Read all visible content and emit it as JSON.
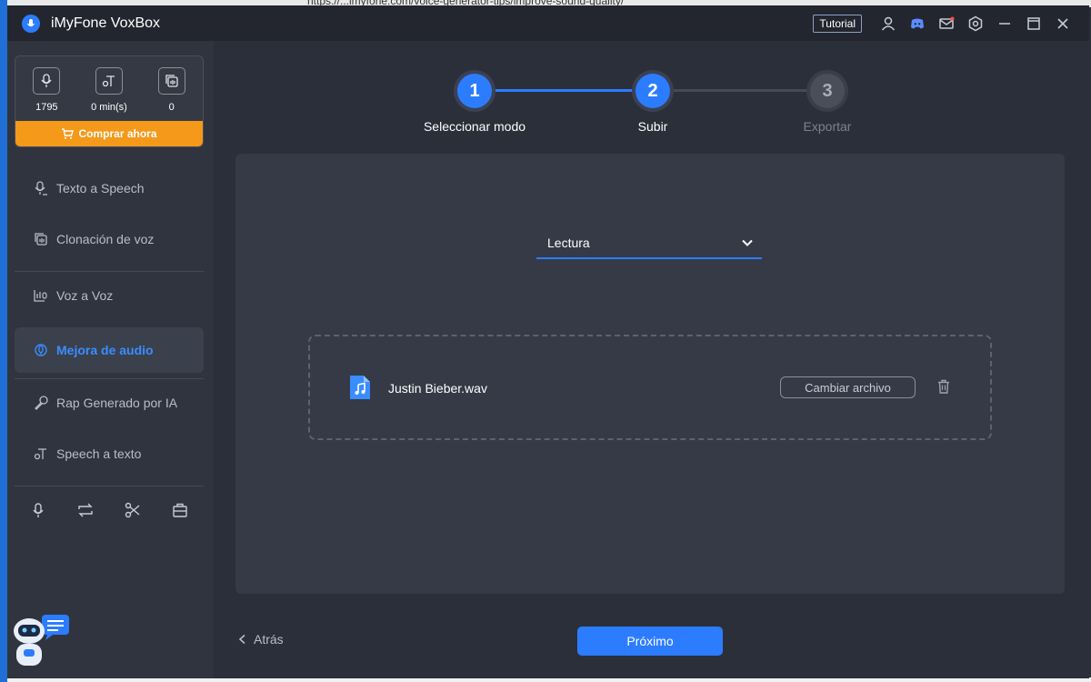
{
  "app": {
    "title": "iMyFone VoxBox",
    "tutorial_label": "Tutorial",
    "browser_url_fragment": "https://...imyfone.com/voice-generator-tips/improve-sound-quality/"
  },
  "sidebar": {
    "stats": [
      {
        "icon": "speech-credits-icon",
        "value": "1795"
      },
      {
        "icon": "time-credits-icon",
        "value": "0 min(s)"
      },
      {
        "icon": "clone-credits-icon",
        "value": "0"
      }
    ],
    "buy_label": "Comprar ahora",
    "items": [
      {
        "label": "Texto a Speech",
        "icon": "text-to-speech-icon"
      },
      {
        "label": "Clonación de voz",
        "icon": "voice-clone-icon"
      },
      {
        "label": "Voz a Voz",
        "icon": "voice-to-voice-icon"
      },
      {
        "label": "Mejora de audio",
        "icon": "audio-enhance-icon",
        "active": true
      },
      {
        "label": "Rap Generado por IA",
        "icon": "ai-rap-icon"
      },
      {
        "label": "Speech a texto",
        "icon": "speech-to-text-icon"
      }
    ],
    "tools": [
      "record-icon",
      "convert-icon",
      "cut-icon",
      "toolbox-icon"
    ]
  },
  "steps": [
    {
      "number": "1",
      "label": "Seleccionar modo",
      "state": "done"
    },
    {
      "number": "2",
      "label": "Subir",
      "state": "done"
    },
    {
      "number": "3",
      "label": "Exportar",
      "state": "todo"
    }
  ],
  "panel": {
    "mode_value": "Lectura",
    "file_name": "Justin Bieber.wav",
    "change_label": "Cambiar archivo"
  },
  "footer": {
    "back_label": "Atrás",
    "next_label": "Próximo"
  },
  "colors": {
    "accent": "#2c7cff",
    "buy": "#f4991a",
    "bg": "#2b2f3a",
    "sidebar": "#30343f"
  }
}
